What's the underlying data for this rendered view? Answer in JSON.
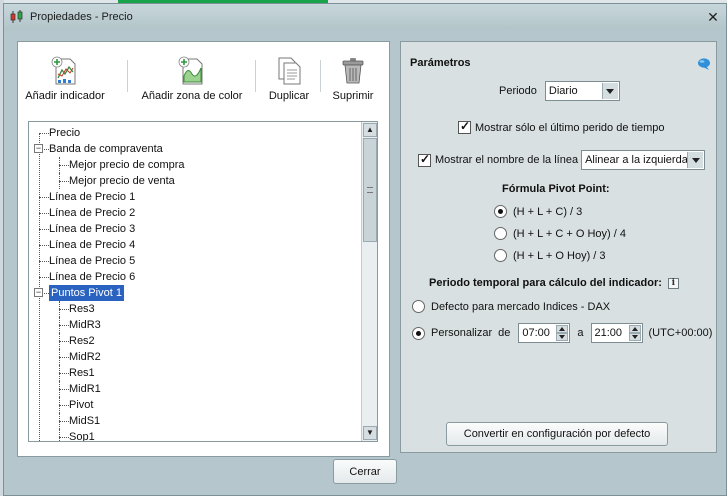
{
  "window": {
    "title": "Propiedades - Precio",
    "close_glyph": "✕"
  },
  "toolbar": {
    "items": [
      {
        "label": "Añadir indicador",
        "icon": "add-indicator-icon"
      },
      {
        "label": "Añadir zona de color",
        "icon": "add-color-zone-icon"
      },
      {
        "label": "Duplicar",
        "icon": "duplicate-icon"
      },
      {
        "label": "Suprimir",
        "icon": "trash-icon"
      }
    ]
  },
  "tree": {
    "nodes": [
      {
        "label": "Precio",
        "level": 0
      },
      {
        "label": "Banda de compraventa",
        "level": 0,
        "expander": "−"
      },
      {
        "label": "Mejor precio de compra",
        "level": 1
      },
      {
        "label": "Mejor precio de venta",
        "level": 1
      },
      {
        "label": "Línea de Precio 1",
        "level": 0
      },
      {
        "label": "Línea de Precio 2",
        "level": 0
      },
      {
        "label": "Línea de Precio 3",
        "level": 0
      },
      {
        "label": "Línea de Precio 4",
        "level": 0
      },
      {
        "label": "Línea de Precio 5",
        "level": 0
      },
      {
        "label": "Línea de Precio 6",
        "level": 0
      },
      {
        "label": "Puntos Pivot 1",
        "level": 0,
        "expander": "−",
        "selected": true
      },
      {
        "label": "Res3",
        "level": 1
      },
      {
        "label": "MidR3",
        "level": 1
      },
      {
        "label": "Res2",
        "level": 1
      },
      {
        "label": "MidR2",
        "level": 1
      },
      {
        "label": "Res1",
        "level": 1
      },
      {
        "label": "MidR1",
        "level": 1
      },
      {
        "label": "Pivot",
        "level": 1
      },
      {
        "label": "MidS1",
        "level": 1
      },
      {
        "label": "Sop1",
        "level": 1
      }
    ],
    "selected_color": "#2a62c2"
  },
  "params": {
    "title": "Parámetros",
    "periodo_label": "Periodo",
    "periodo_value": "Diario",
    "only_last_label": "Mostrar sólo el último perido de tiempo",
    "only_last_checked": true,
    "show_name_label": "Mostrar el nombre de la línea",
    "show_name_checked": true,
    "align_value": "Alinear a la izquierda",
    "formula_title": "Fórmula Pivot Point:",
    "formulas": [
      {
        "label": "(H + L + C) / 3",
        "selected": true
      },
      {
        "label": "(H + L + C + O Hoy) / 4",
        "selected": false
      },
      {
        "label": "(H + L + O Hoy) / 3",
        "selected": false
      }
    ],
    "period_title": "Periodo temporal para cálculo del indicador:",
    "info_glyph": "i",
    "default_option_label": "Defecto para mercado Indices - DAX",
    "default_option_selected": false,
    "custom_label": "Personalizar",
    "de_label": "de",
    "from_time": "07:00",
    "a_label": "a",
    "to_time": "21:00",
    "timezone": "(UTC+00:00)",
    "custom_selected": true,
    "convert_button": "Convertir en configuración por defecto"
  },
  "footer": {
    "close_button": "Cerrar"
  },
  "colors": {
    "window_bg": "#b5c7cc",
    "panel_bg": "#d9e0e2",
    "selection": "#2a62c2",
    "help_bubble": "#2f8fd8"
  }
}
